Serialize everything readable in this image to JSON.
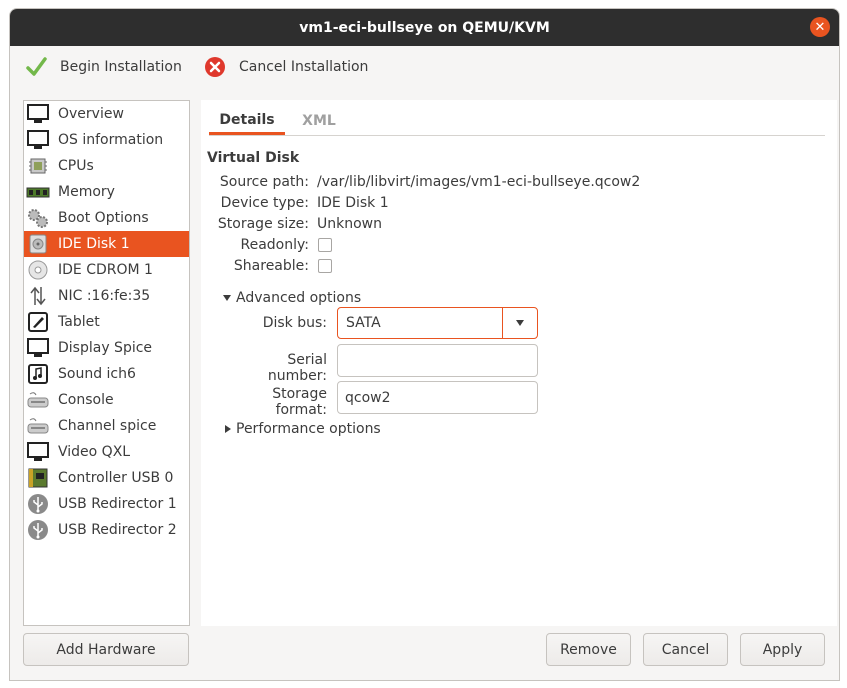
{
  "window": {
    "title": "vm1-eci-bullseye on QEMU/KVM",
    "close_glyph": "✕"
  },
  "toolbar": {
    "begin_label": "Begin Installation",
    "cancel_label": "Cancel Installation"
  },
  "sidebar": {
    "items": [
      {
        "label": "Overview",
        "icon": "monitor-icon"
      },
      {
        "label": "OS information",
        "icon": "monitor-icon"
      },
      {
        "label": "CPUs",
        "icon": "cpu-icon"
      },
      {
        "label": "Memory",
        "icon": "memory-icon"
      },
      {
        "label": "Boot Options",
        "icon": "gears-icon"
      },
      {
        "label": "IDE Disk 1",
        "icon": "disk-icon",
        "selected": true
      },
      {
        "label": "IDE CDROM 1",
        "icon": "cdrom-icon"
      },
      {
        "label": "NIC :16:fe:35",
        "icon": "network-icon"
      },
      {
        "label": "Tablet",
        "icon": "tablet-icon"
      },
      {
        "label": "Display Spice",
        "icon": "monitor-icon"
      },
      {
        "label": "Sound ich6",
        "icon": "sound-icon"
      },
      {
        "label": "Console",
        "icon": "console-icon"
      },
      {
        "label": "Channel spice",
        "icon": "console-icon"
      },
      {
        "label": "Video QXL",
        "icon": "monitor-icon"
      },
      {
        "label": "Controller USB 0",
        "icon": "controller-icon"
      },
      {
        "label": "USB Redirector 1",
        "icon": "usb-icon"
      },
      {
        "label": "USB Redirector 2",
        "icon": "usb-icon"
      }
    ]
  },
  "tabs": {
    "details": "Details",
    "xml": "XML"
  },
  "disk": {
    "section_title": "Virtual Disk",
    "source_path_label": "Source path:",
    "source_path": "/var/lib/libvirt/images/vm1-eci-bullseye.qcow2",
    "device_type_label": "Device type:",
    "device_type": "IDE Disk 1",
    "storage_size_label": "Storage size:",
    "storage_size": "Unknown",
    "readonly_label": "Readonly:",
    "shareable_label": "Shareable:",
    "readonly_checked": false,
    "shareable_checked": false
  },
  "advanced": {
    "expander_label": "Advanced options",
    "disk_bus_label": "Disk bus:",
    "disk_bus_value": "SATA",
    "serial_label": "Serial number:",
    "serial_value": "",
    "format_label": "Storage format:",
    "format_value": "qcow2"
  },
  "performance": {
    "expander_label": "Performance options"
  },
  "buttons": {
    "add_hardware": "Add Hardware",
    "remove": "Remove",
    "cancel": "Cancel",
    "apply": "Apply"
  },
  "colors": {
    "accent": "#e95420",
    "titlebar": "#2e2e2e",
    "background": "#f6f5f4"
  }
}
